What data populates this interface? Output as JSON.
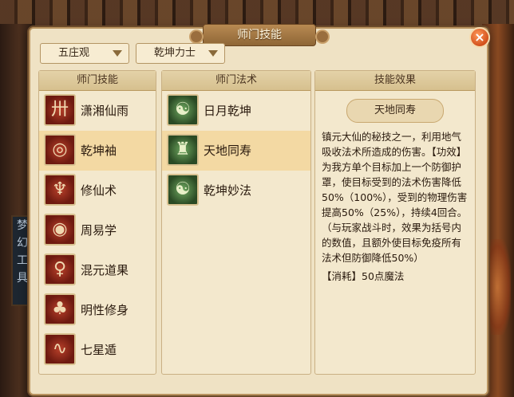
{
  "window_title": "师门技能",
  "dropdowns": {
    "school": "五庄观",
    "title": "乾坤力士"
  },
  "columns": {
    "skills": "师门技能",
    "spells": "师门法术",
    "effect": "技能效果"
  },
  "skills": [
    {
      "label": "潇湘仙雨",
      "icon": "scroll-icon"
    },
    {
      "label": "乾坤袖",
      "icon": "sleeve-icon"
    },
    {
      "label": "修仙术",
      "icon": "crane-icon"
    },
    {
      "label": "周易学",
      "icon": "spiral-icon"
    },
    {
      "label": "混元道果",
      "icon": "fruit-icon"
    },
    {
      "label": "明性修身",
      "icon": "tree-icon"
    },
    {
      "label": "七星遁",
      "icon": "stars-icon"
    }
  ],
  "selected_skill": "乾坤袖",
  "spells": [
    {
      "label": "日月乾坤",
      "icon": "taiji-icon"
    },
    {
      "label": "天地同寿",
      "icon": "figure-icon"
    },
    {
      "label": "乾坤妙法",
      "icon": "taiji-icon"
    }
  ],
  "selected_spell": "天地同寿",
  "effect": {
    "name": "天地同寿",
    "description": "镇元大仙的秘技之一，利用地气吸收法术所造成的伤害。【功效】为我方单个目标加上一个防御护罩，使目标受到的法术伤害降低50%（100%），受到的物理伤害提高50%（25%），持续4回合。（与玩家战斗时，效果为括号内的数值，且额外使目标免疫所有法术但防御降低50%）",
    "cost": "【消耗】50点魔法"
  },
  "background_sign": "梦幻工具",
  "colors": {
    "panel": "#efe2c4",
    "selected_row": "#f3d9a3",
    "close": "#d2501c"
  }
}
